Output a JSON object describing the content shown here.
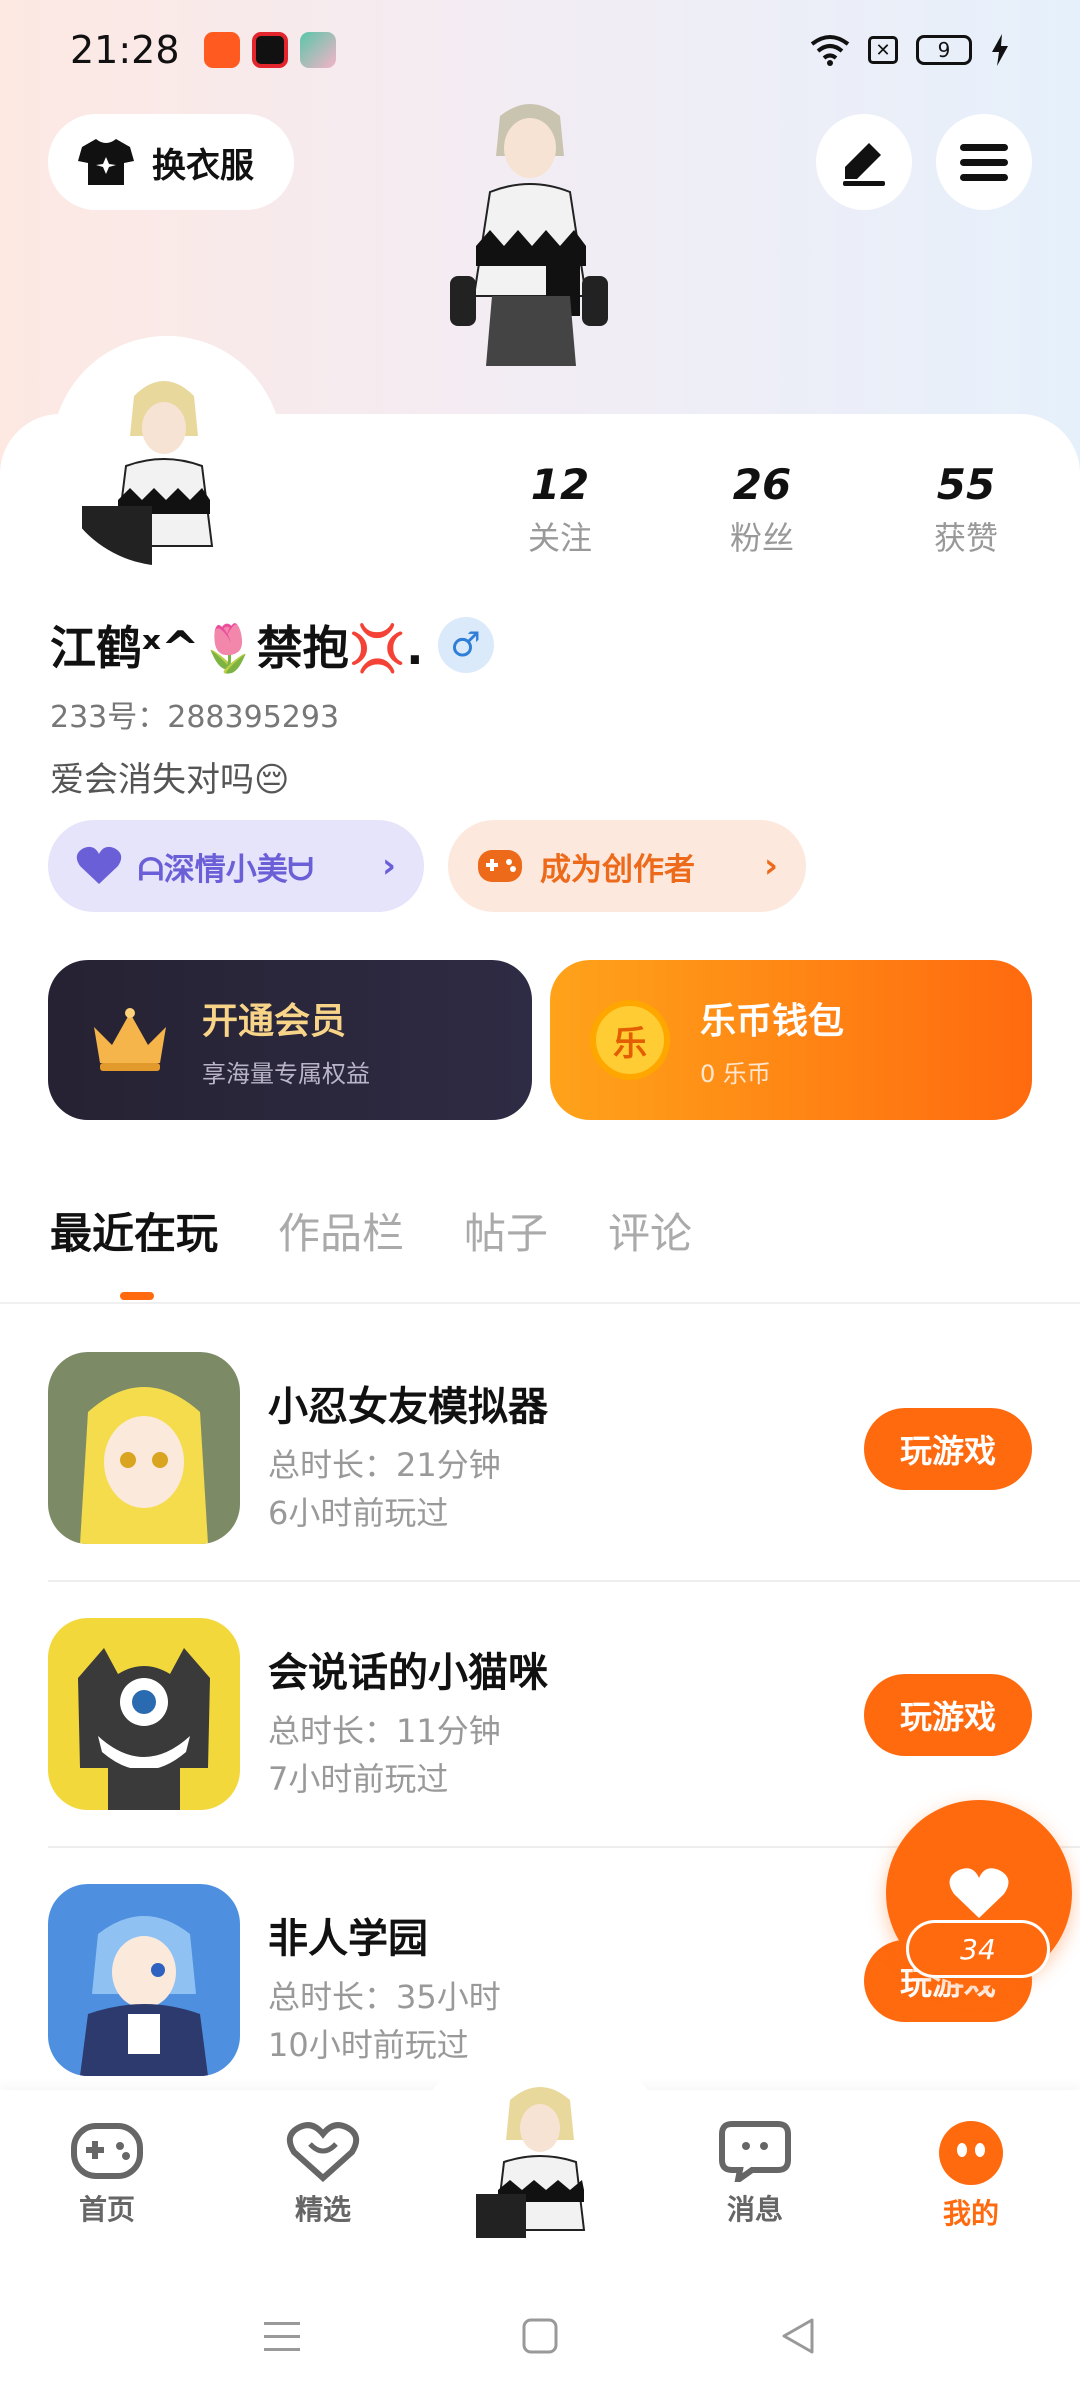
{
  "status_bar": {
    "time": "21:28",
    "battery": "9",
    "app_icons": [
      {
        "name": "kuaishou-icon",
        "color": "#ff5a1f"
      },
      {
        "name": "video-record-icon",
        "color": "#e3262d"
      },
      {
        "name": "game-app-icon",
        "color": "#59c6a8"
      }
    ]
  },
  "header": {
    "outfit_label": "换衣服"
  },
  "profile": {
    "stats": [
      {
        "value": "12",
        "label": "关注"
      },
      {
        "value": "26",
        "label": "粉丝"
      },
      {
        "value": "55",
        "label": "获赞"
      }
    ],
    "username": "江鹤ˣ^🌷禁抱💢.",
    "gender_symbol": "♂",
    "uid": "233号：288395293",
    "bio": "爱会消失对吗😔",
    "intimacy_pill": "ᗩ深情小美ᗨ",
    "creator_pill": "成为创作者",
    "vip": {
      "title": "开通会员",
      "subtitle": "享海量专属权益"
    },
    "wallet": {
      "title": "乐币钱包",
      "subtitle": "0 乐币",
      "coin_char": "乐"
    }
  },
  "tabs": [
    {
      "label": "最近在玩",
      "active": true
    },
    {
      "label": "作品栏",
      "active": false
    },
    {
      "label": "帖子",
      "active": false
    },
    {
      "label": "评论",
      "active": false
    }
  ],
  "games": [
    {
      "name": "小忍女友模拟器",
      "duration": "总时长：21分钟",
      "last_played": "6小时前玩过",
      "button": "玩游戏"
    },
    {
      "name": "会说话的小猫咪",
      "duration": "总时长：11分钟",
      "last_played": "7小时前玩过",
      "button": "玩游戏"
    },
    {
      "name": "非人学园",
      "duration": "总时长：35小时",
      "last_played": "10小时前玩过",
      "button": "玩游戏"
    }
  ],
  "like_fab": {
    "count": "34"
  },
  "bottom_nav": [
    {
      "label": "首页",
      "icon": "gamepad-icon"
    },
    {
      "label": "精选",
      "icon": "heart-chat-icon"
    },
    {
      "label": "消息",
      "icon": "message-icon"
    },
    {
      "label": "我的",
      "icon": "profile-face-icon"
    }
  ],
  "colors": {
    "accent": "#ff6a0f",
    "intimacy": "#6b5fd8",
    "vip_gold": "#f8d488"
  }
}
